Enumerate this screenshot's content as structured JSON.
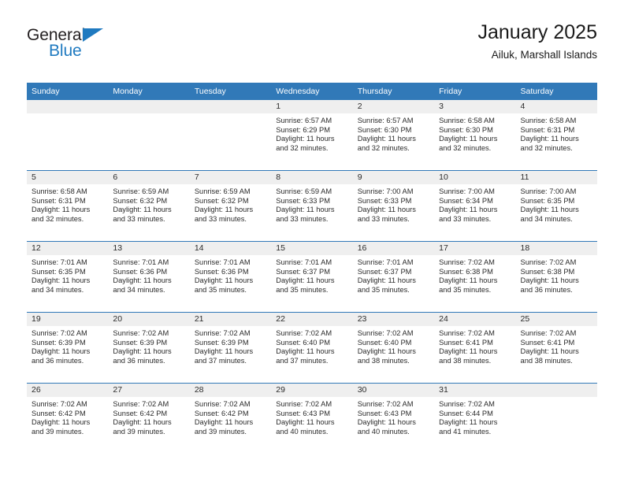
{
  "brand": {
    "name_part1": "General",
    "name_part2": "Blue",
    "accent_color": "#1f7ac0"
  },
  "header": {
    "title": "January 2025",
    "subtitle": "Ailuk, Marshall Islands",
    "header_bg_color": "#3179b8",
    "daynum_band_color": "#efefef"
  },
  "weekday_headers": [
    "Sunday",
    "Monday",
    "Tuesday",
    "Wednesday",
    "Thursday",
    "Friday",
    "Saturday"
  ],
  "weeks": [
    [
      {
        "day": "",
        "empty": true
      },
      {
        "day": "",
        "empty": true
      },
      {
        "day": "",
        "empty": true
      },
      {
        "day": "1",
        "sunrise": "Sunrise: 6:57 AM",
        "sunset": "Sunset: 6:29 PM",
        "daylight1": "Daylight: 11 hours",
        "daylight2": "and 32 minutes."
      },
      {
        "day": "2",
        "sunrise": "Sunrise: 6:57 AM",
        "sunset": "Sunset: 6:30 PM",
        "daylight1": "Daylight: 11 hours",
        "daylight2": "and 32 minutes."
      },
      {
        "day": "3",
        "sunrise": "Sunrise: 6:58 AM",
        "sunset": "Sunset: 6:30 PM",
        "daylight1": "Daylight: 11 hours",
        "daylight2": "and 32 minutes."
      },
      {
        "day": "4",
        "sunrise": "Sunrise: 6:58 AM",
        "sunset": "Sunset: 6:31 PM",
        "daylight1": "Daylight: 11 hours",
        "daylight2": "and 32 minutes."
      }
    ],
    [
      {
        "day": "5",
        "sunrise": "Sunrise: 6:58 AM",
        "sunset": "Sunset: 6:31 PM",
        "daylight1": "Daylight: 11 hours",
        "daylight2": "and 32 minutes."
      },
      {
        "day": "6",
        "sunrise": "Sunrise: 6:59 AM",
        "sunset": "Sunset: 6:32 PM",
        "daylight1": "Daylight: 11 hours",
        "daylight2": "and 33 minutes."
      },
      {
        "day": "7",
        "sunrise": "Sunrise: 6:59 AM",
        "sunset": "Sunset: 6:32 PM",
        "daylight1": "Daylight: 11 hours",
        "daylight2": "and 33 minutes."
      },
      {
        "day": "8",
        "sunrise": "Sunrise: 6:59 AM",
        "sunset": "Sunset: 6:33 PM",
        "daylight1": "Daylight: 11 hours",
        "daylight2": "and 33 minutes."
      },
      {
        "day": "9",
        "sunrise": "Sunrise: 7:00 AM",
        "sunset": "Sunset: 6:33 PM",
        "daylight1": "Daylight: 11 hours",
        "daylight2": "and 33 minutes."
      },
      {
        "day": "10",
        "sunrise": "Sunrise: 7:00 AM",
        "sunset": "Sunset: 6:34 PM",
        "daylight1": "Daylight: 11 hours",
        "daylight2": "and 33 minutes."
      },
      {
        "day": "11",
        "sunrise": "Sunrise: 7:00 AM",
        "sunset": "Sunset: 6:35 PM",
        "daylight1": "Daylight: 11 hours",
        "daylight2": "and 34 minutes."
      }
    ],
    [
      {
        "day": "12",
        "sunrise": "Sunrise: 7:01 AM",
        "sunset": "Sunset: 6:35 PM",
        "daylight1": "Daylight: 11 hours",
        "daylight2": "and 34 minutes."
      },
      {
        "day": "13",
        "sunrise": "Sunrise: 7:01 AM",
        "sunset": "Sunset: 6:36 PM",
        "daylight1": "Daylight: 11 hours",
        "daylight2": "and 34 minutes."
      },
      {
        "day": "14",
        "sunrise": "Sunrise: 7:01 AM",
        "sunset": "Sunset: 6:36 PM",
        "daylight1": "Daylight: 11 hours",
        "daylight2": "and 35 minutes."
      },
      {
        "day": "15",
        "sunrise": "Sunrise: 7:01 AM",
        "sunset": "Sunset: 6:37 PM",
        "daylight1": "Daylight: 11 hours",
        "daylight2": "and 35 minutes."
      },
      {
        "day": "16",
        "sunrise": "Sunrise: 7:01 AM",
        "sunset": "Sunset: 6:37 PM",
        "daylight1": "Daylight: 11 hours",
        "daylight2": "and 35 minutes."
      },
      {
        "day": "17",
        "sunrise": "Sunrise: 7:02 AM",
        "sunset": "Sunset: 6:38 PM",
        "daylight1": "Daylight: 11 hours",
        "daylight2": "and 35 minutes."
      },
      {
        "day": "18",
        "sunrise": "Sunrise: 7:02 AM",
        "sunset": "Sunset: 6:38 PM",
        "daylight1": "Daylight: 11 hours",
        "daylight2": "and 36 minutes."
      }
    ],
    [
      {
        "day": "19",
        "sunrise": "Sunrise: 7:02 AM",
        "sunset": "Sunset: 6:39 PM",
        "daylight1": "Daylight: 11 hours",
        "daylight2": "and 36 minutes."
      },
      {
        "day": "20",
        "sunrise": "Sunrise: 7:02 AM",
        "sunset": "Sunset: 6:39 PM",
        "daylight1": "Daylight: 11 hours",
        "daylight2": "and 36 minutes."
      },
      {
        "day": "21",
        "sunrise": "Sunrise: 7:02 AM",
        "sunset": "Sunset: 6:39 PM",
        "daylight1": "Daylight: 11 hours",
        "daylight2": "and 37 minutes."
      },
      {
        "day": "22",
        "sunrise": "Sunrise: 7:02 AM",
        "sunset": "Sunset: 6:40 PM",
        "daylight1": "Daylight: 11 hours",
        "daylight2": "and 37 minutes."
      },
      {
        "day": "23",
        "sunrise": "Sunrise: 7:02 AM",
        "sunset": "Sunset: 6:40 PM",
        "daylight1": "Daylight: 11 hours",
        "daylight2": "and 38 minutes."
      },
      {
        "day": "24",
        "sunrise": "Sunrise: 7:02 AM",
        "sunset": "Sunset: 6:41 PM",
        "daylight1": "Daylight: 11 hours",
        "daylight2": "and 38 minutes."
      },
      {
        "day": "25",
        "sunrise": "Sunrise: 7:02 AM",
        "sunset": "Sunset: 6:41 PM",
        "daylight1": "Daylight: 11 hours",
        "daylight2": "and 38 minutes."
      }
    ],
    [
      {
        "day": "26",
        "sunrise": "Sunrise: 7:02 AM",
        "sunset": "Sunset: 6:42 PM",
        "daylight1": "Daylight: 11 hours",
        "daylight2": "and 39 minutes."
      },
      {
        "day": "27",
        "sunrise": "Sunrise: 7:02 AM",
        "sunset": "Sunset: 6:42 PM",
        "daylight1": "Daylight: 11 hours",
        "daylight2": "and 39 minutes."
      },
      {
        "day": "28",
        "sunrise": "Sunrise: 7:02 AM",
        "sunset": "Sunset: 6:42 PM",
        "daylight1": "Daylight: 11 hours",
        "daylight2": "and 39 minutes."
      },
      {
        "day": "29",
        "sunrise": "Sunrise: 7:02 AM",
        "sunset": "Sunset: 6:43 PM",
        "daylight1": "Daylight: 11 hours",
        "daylight2": "and 40 minutes."
      },
      {
        "day": "30",
        "sunrise": "Sunrise: 7:02 AM",
        "sunset": "Sunset: 6:43 PM",
        "daylight1": "Daylight: 11 hours",
        "daylight2": "and 40 minutes."
      },
      {
        "day": "31",
        "sunrise": "Sunrise: 7:02 AM",
        "sunset": "Sunset: 6:44 PM",
        "daylight1": "Daylight: 11 hours",
        "daylight2": "and 41 minutes."
      },
      {
        "day": "",
        "empty": true
      }
    ]
  ]
}
